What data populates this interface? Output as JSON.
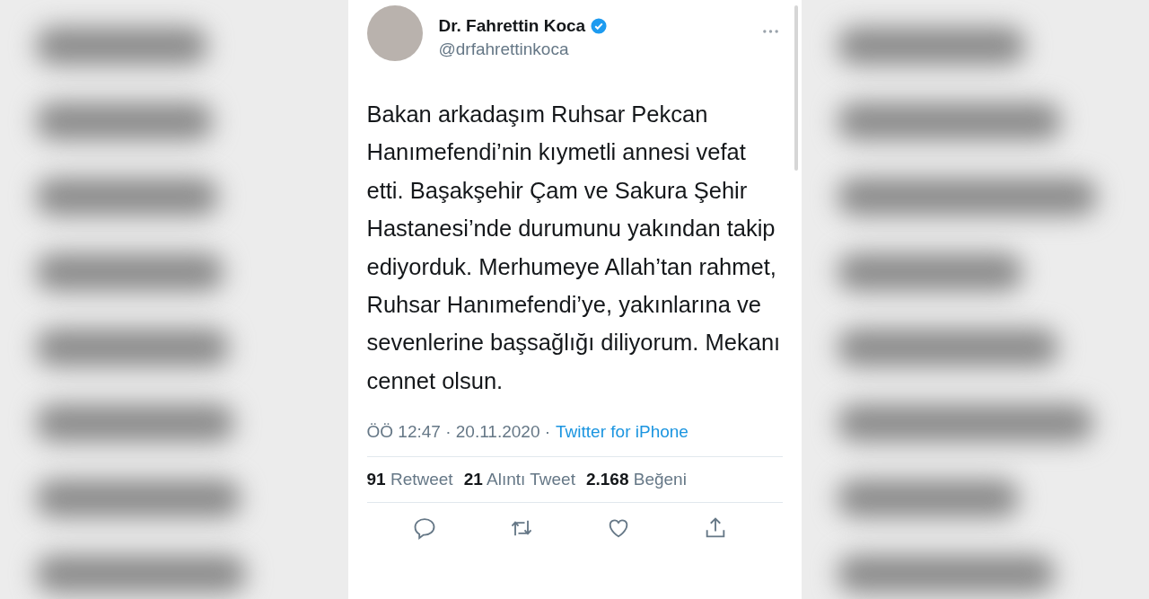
{
  "tweet": {
    "author": {
      "name": "Dr. Fahrettin Koca",
      "handle": "@drfahrettinkoca",
      "verified": true
    },
    "text": "Bakan arkadaşım Ruhsar Pekcan Hanımefendi’nin kıymetli annesi vefat etti. Başakşehir Çam ve Sakura Şehir Hastanesi’nde durumunu yakından takip ediyorduk. Merhumeye Allah’tan rahmet, Ruhsar Hanımefendi’ye, yakınlarına ve sevenlerine başsağlığı diliyorum. Mekanı cennet olsun.",
    "time": "ÖÖ 12:47 · 20.11.2020 ·",
    "source": "Twitter for iPhone",
    "stats": [
      "**91** Retweet",
      "**21** Alıntı Tweet",
      "**2.168** Beğeni"
    ],
    "actions": [
      {
        "kind": "reply"
      },
      {
        "kind": "retweet"
      },
      {
        "kind": "like"
      },
      {
        "kind": "share"
      }
    ]
  }
}
